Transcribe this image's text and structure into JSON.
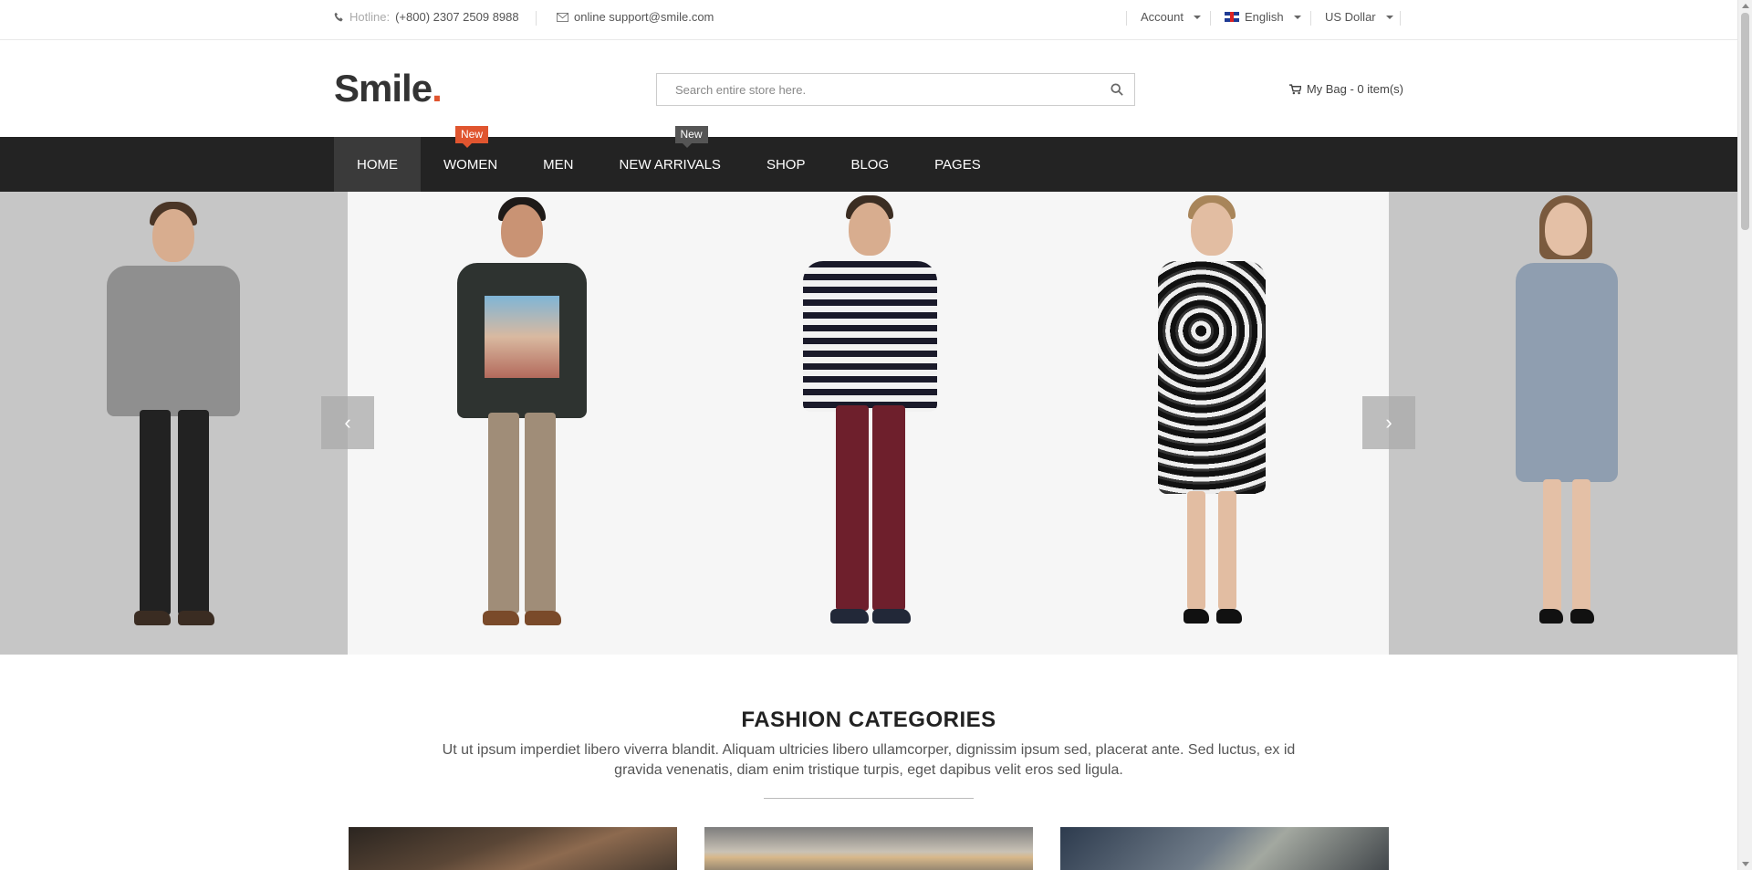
{
  "topbar": {
    "hotline_label": "Hotline:",
    "hotline_number": "(+800) 2307 2509 8988",
    "email": "online support@smile.com",
    "account": "Account",
    "language": "English",
    "currency": "US Dollar"
  },
  "header": {
    "logo_text": "Smile",
    "logo_dot": ".",
    "search_placeholder": "Search entire store here.",
    "bag_label": "My Bag - 0 item(s)"
  },
  "nav": {
    "items": [
      {
        "label": "HOME"
      },
      {
        "label": "WOMEN",
        "badge": "New"
      },
      {
        "label": "MEN"
      },
      {
        "label": "NEW ARRIVALS",
        "badge": "New"
      },
      {
        "label": "SHOP"
      },
      {
        "label": "BLOG"
      },
      {
        "label": "PAGES"
      }
    ]
  },
  "slider": {
    "prev_icon": "chevron-left-icon",
    "next_icon": "chevron-right-icon",
    "prev_glyph": "‹",
    "next_glyph": "›"
  },
  "categories": {
    "title": "FASHION CATEGORIES",
    "description": "Ut ut ipsum imperdiet libero viverra blandit. Aliquam ultricies libero ullamcorper, dignissim ipsum sed, placerat ante. Sed luctus, ex id gravida venenatis, diam enim tristique turpis, eget dapibus velit eros sed ligula."
  },
  "colors": {
    "accent": "#e0552f",
    "nav_bg": "#232323",
    "nav_active": "#3a3a3a"
  }
}
